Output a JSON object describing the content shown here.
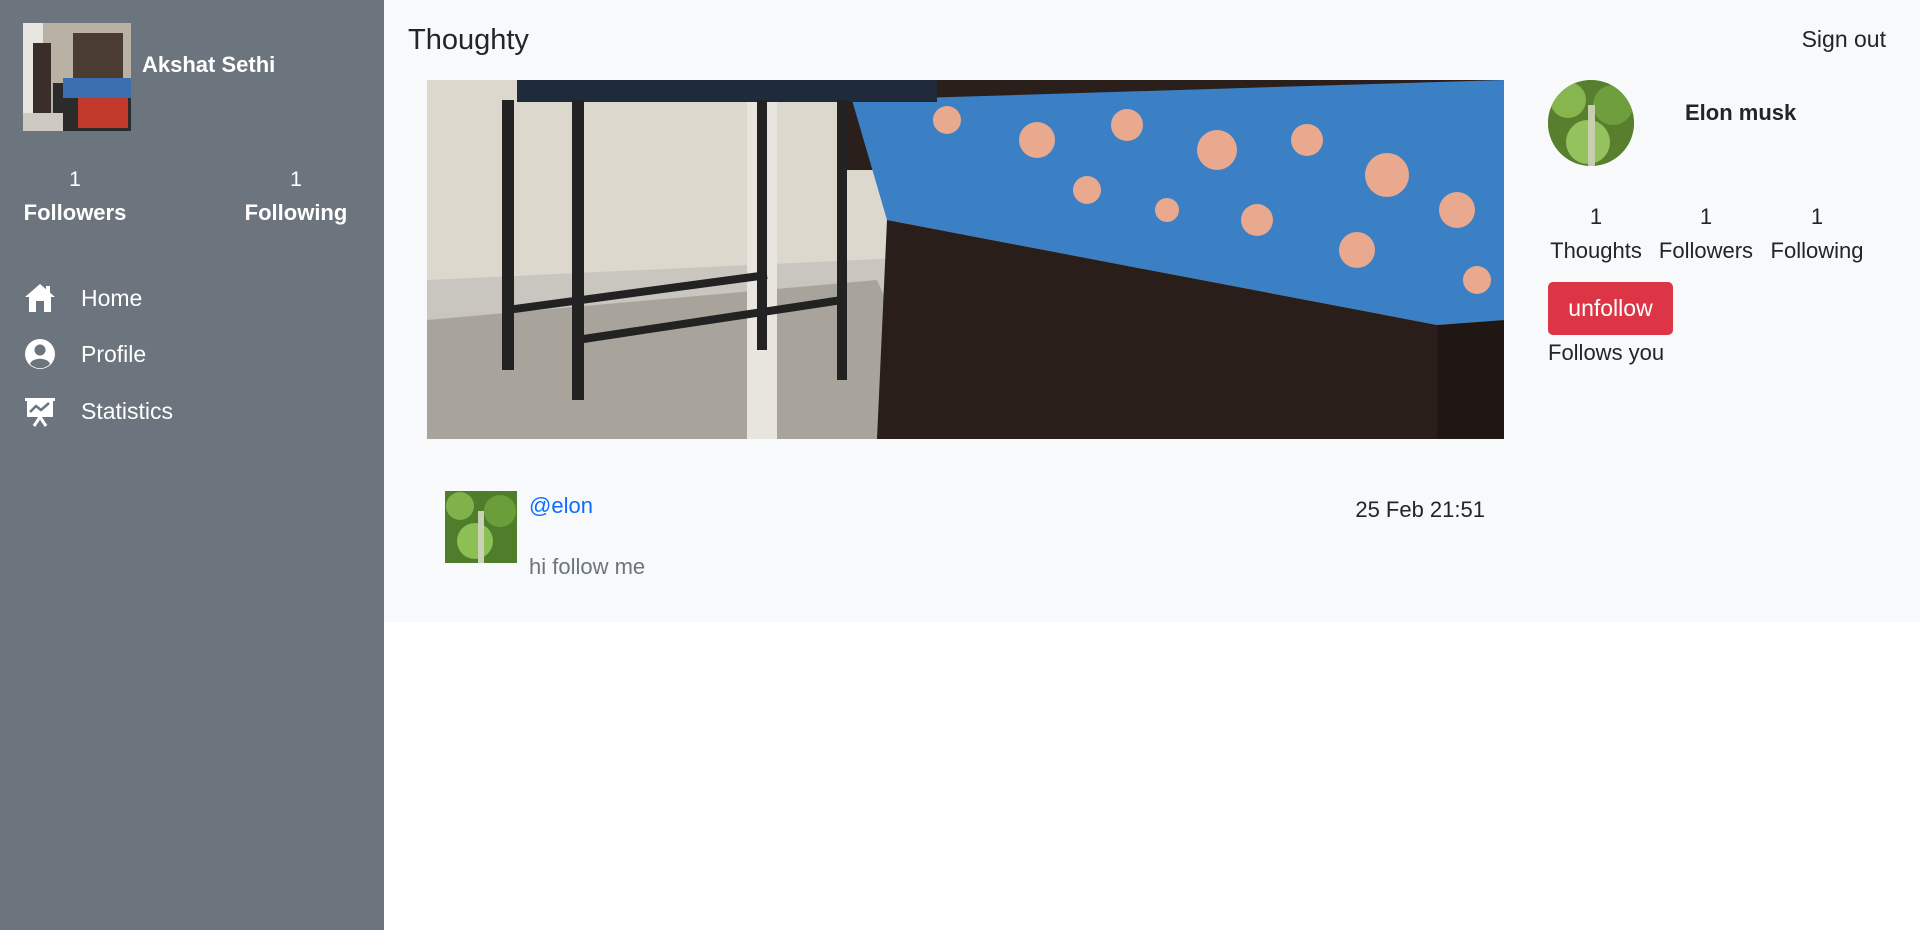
{
  "app": {
    "brand": "Thoughty",
    "sign_out": "Sign out"
  },
  "sidebar": {
    "user_name": "Akshat Sethi",
    "followers": {
      "count": "1",
      "label": "Followers"
    },
    "following": {
      "count": "1",
      "label": "Following"
    },
    "nav": [
      {
        "label": "Home",
        "icon": "home-icon"
      },
      {
        "label": "Profile",
        "icon": "user-circle-icon"
      },
      {
        "label": "Statistics",
        "icon": "presentation-chart-icon"
      }
    ]
  },
  "profile_card": {
    "name": "Elon musk",
    "stats": [
      {
        "count": "1",
        "label": "Thoughts"
      },
      {
        "count": "1",
        "label": "Followers"
      },
      {
        "count": "1",
        "label": "Following"
      }
    ],
    "unfollow_label": "unfollow",
    "follows_you": "Follows you"
  },
  "post": {
    "handle": "@elon",
    "time": "25 Feb 21:51",
    "text": "hi follow me"
  },
  "colors": {
    "sidebar_bg": "#6c757d",
    "main_bg": "#f8f9fa",
    "link": "#0d6efd",
    "danger": "#dc3545"
  }
}
